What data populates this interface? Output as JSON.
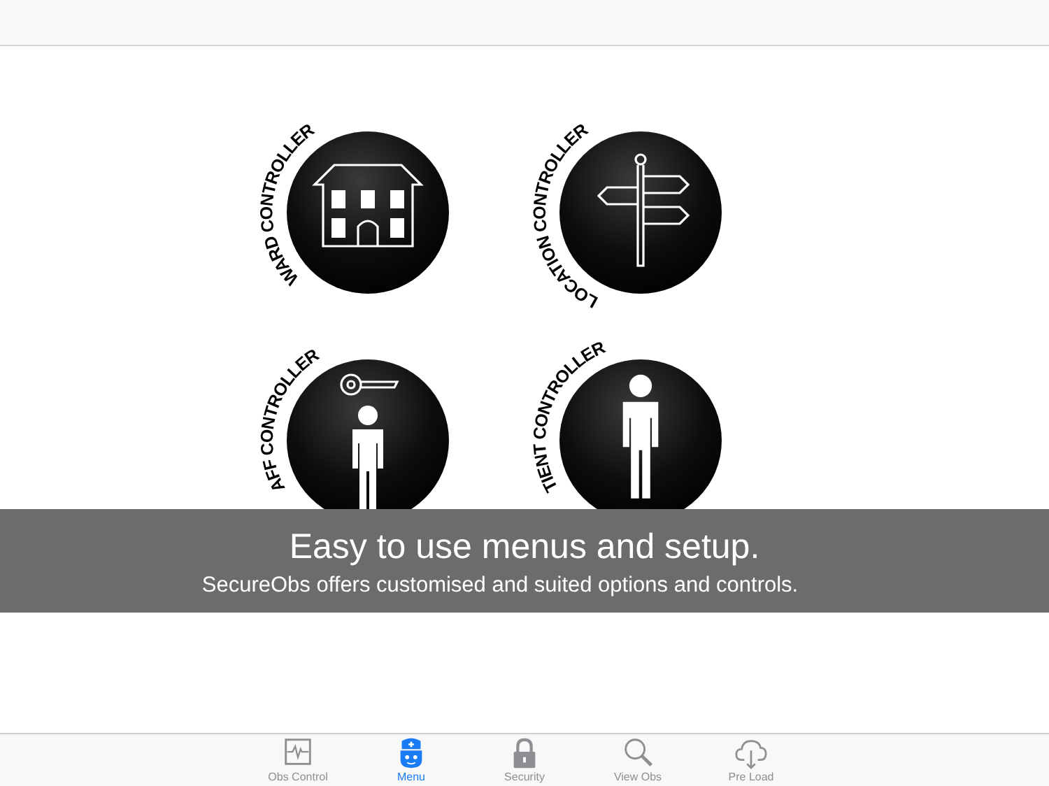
{
  "tiles": [
    {
      "label": "WARD CONTROLLER",
      "kind": "ward"
    },
    {
      "label": "LOCATION CONTROLLER",
      "kind": "location"
    },
    {
      "label": "AFF CONTROLLER",
      "kind": "staff"
    },
    {
      "label": "TIENT CONTROLLER",
      "kind": "patient"
    }
  ],
  "banner": {
    "title": "Easy to use menus and setup.",
    "subtitle": "SecureObs offers customised and suited options and controls."
  },
  "tab_bar": [
    {
      "label": "Obs Control",
      "kind": "obs",
      "selected": false
    },
    {
      "label": "Menu",
      "kind": "menu",
      "selected": true
    },
    {
      "label": "Security",
      "kind": "security",
      "selected": false
    },
    {
      "label": "View Obs",
      "kind": "view",
      "selected": false
    },
    {
      "label": "Pre Load",
      "kind": "preload",
      "selected": false
    }
  ]
}
